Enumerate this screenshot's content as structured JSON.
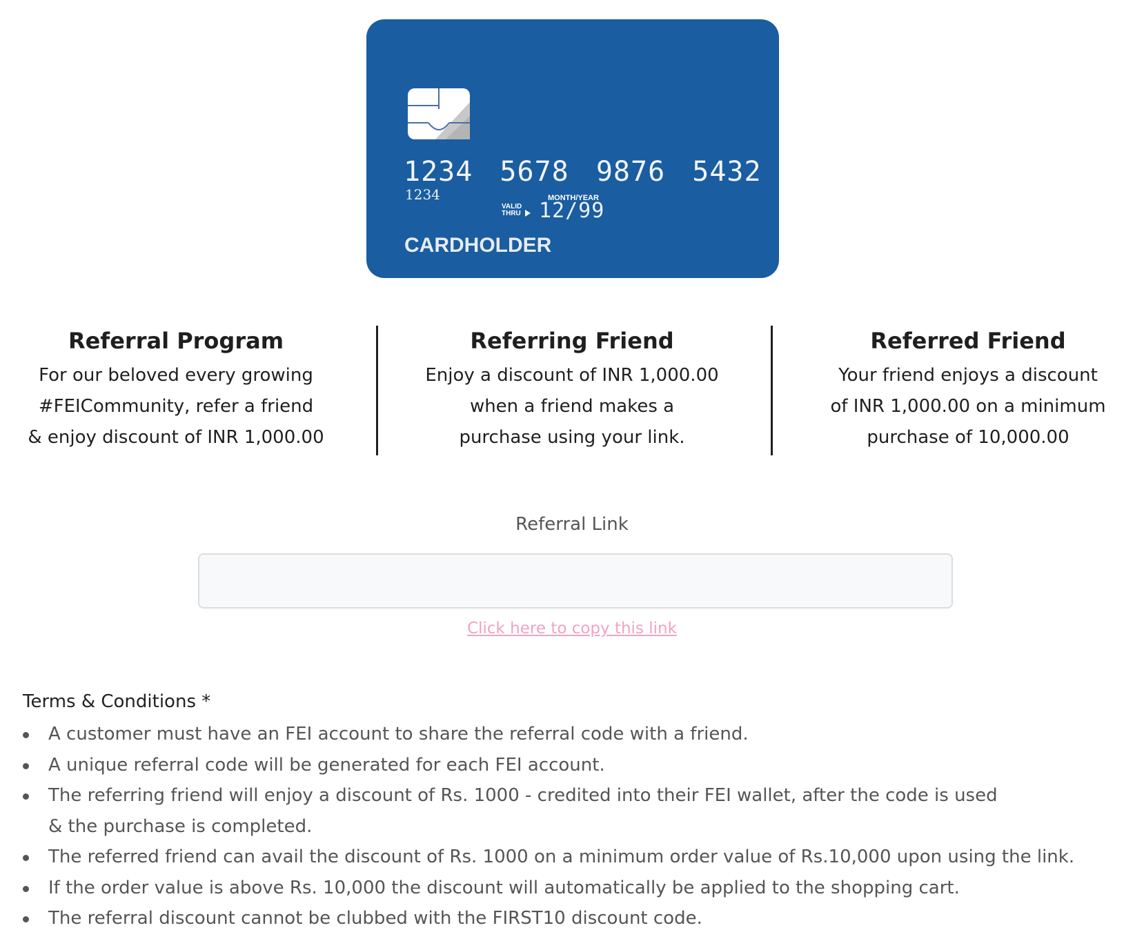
{
  "card": {
    "number": "1234 5678 9876 5432",
    "small_number": "1234",
    "month_year_label": "MONTH/YEAR",
    "valid_thru_label": "VALID\nTHRU",
    "expiry": "12/99",
    "cardholder": "CARDHOLDER",
    "color": "#1a5da0"
  },
  "columns": [
    {
      "title": "Referral Program",
      "lines": [
        "For our beloved every growing",
        "#FEICommunity, refer a friend",
        "& enjoy discount of INR 1,000.00"
      ]
    },
    {
      "title": "Referring Friend",
      "lines": [
        "Enjoy a discount of INR 1,000.00",
        "when a friend makes a",
        "purchase using your link."
      ]
    },
    {
      "title": "Referred Friend",
      "lines": [
        "Your friend enjoys a discount",
        "of INR 1,000.00 on a minimum",
        "purchase of 10,000.00"
      ]
    }
  ],
  "referral": {
    "label": "Referral Link",
    "value": "",
    "copy_label": "Click here to copy this link",
    "link_color": "#f0a3c0"
  },
  "terms": {
    "title": "Terms & Conditions *",
    "items": [
      "A customer must have an FEI account to share the referral code with a friend.",
      "A unique referral code will be generated for each FEI account.",
      "The referring friend will enjoy a discount of Rs. 1000 - credited into their FEI wallet, after the code is used",
      "& the purchase is completed.",
      "The referred friend can avail the discount of Rs. 1000 on a minimum order value of Rs.10,000 upon using the link.",
      "If the order value is above Rs. 10,000 the discount will automatically be applied to the shopping cart.",
      "The referral discount cannot be clubbed with the FIRST10 discount code."
    ]
  }
}
